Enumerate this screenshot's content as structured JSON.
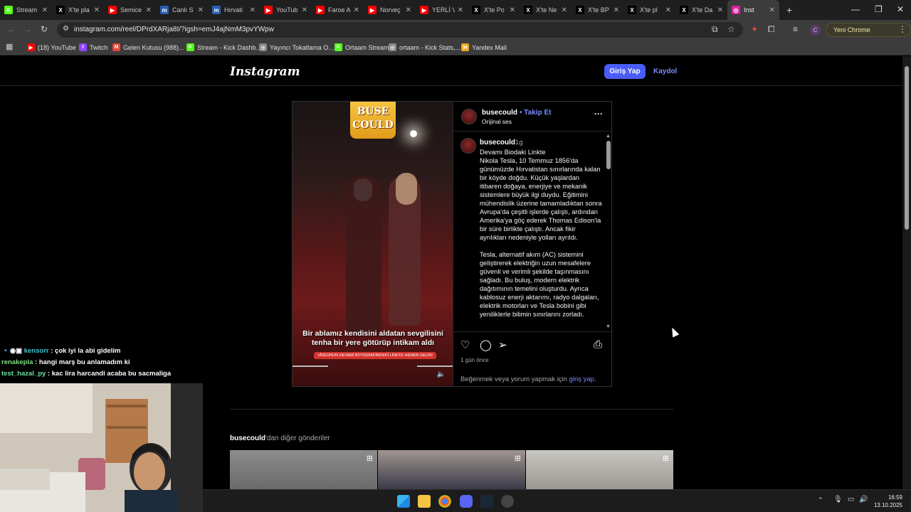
{
  "browser": {
    "tabs": [
      {
        "label": "Stream",
        "color": "#53fc18",
        "glyph": "K"
      },
      {
        "label": "X'te pla",
        "color": "#000000",
        "glyph": "X"
      },
      {
        "label": "Semice",
        "color": "#ff0000",
        "glyph": "▶"
      },
      {
        "label": "Canlı S",
        "color": "#2a5db0",
        "glyph": "m"
      },
      {
        "label": "Hırvati",
        "color": "#2a5db0",
        "glyph": "m"
      },
      {
        "label": "YouTub",
        "color": "#ff0000",
        "glyph": "▶"
      },
      {
        "label": "Faroe A",
        "color": "#ff0000",
        "glyph": "▶"
      },
      {
        "label": "Norveç",
        "color": "#ff0000",
        "glyph": "▶"
      },
      {
        "label": "YERLİ V",
        "color": "#ff0000",
        "glyph": "▶"
      },
      {
        "label": "X'te Po",
        "color": "#000000",
        "glyph": "X"
      },
      {
        "label": "X'te Ne",
        "color": "#000000",
        "glyph": "X"
      },
      {
        "label": "X'te BP",
        "color": "#000000",
        "glyph": "X"
      },
      {
        "label": "X'te pl",
        "color": "#000000",
        "glyph": "X"
      },
      {
        "label": "X'te Da",
        "color": "#000000",
        "glyph": "X"
      },
      {
        "label": "Inst",
        "color": "#d6249f",
        "glyph": "◎",
        "active": true
      }
    ],
    "new_tab": "+",
    "url": "instagram.com/reel/DPrdXARja8I/?igsh=emJ4ajNmM3pvYWpw",
    "update_button": "Yeni Chrome kullanılabilir",
    "profile_initial": "C",
    "bookmarks": [
      {
        "label": "(18) YouTube",
        "color": "#ff0000",
        "glyph": "▶"
      },
      {
        "label": "Twitch",
        "color": "#9146ff",
        "glyph": "t"
      },
      {
        "label": "Gelen Kutusu (988)...",
        "color": "#ea4335",
        "glyph": "M"
      },
      {
        "label": "Stream - Kick Dashb...",
        "color": "#53fc18",
        "glyph": "K"
      },
      {
        "label": "Yayıncı Tokatlama O...",
        "color": "#888888",
        "glyph": "◎"
      },
      {
        "label": "Ortaam Stream",
        "color": "#53fc18",
        "glyph": "K"
      },
      {
        "label": "ortaam - Kick Stats,...",
        "color": "#888888",
        "glyph": "◎"
      },
      {
        "label": "Yandex Mail",
        "color": "#f5a623",
        "glyph": "✉"
      }
    ]
  },
  "instagram": {
    "logo": "Instagram",
    "login_button": "Giriş Yap",
    "signup_link": "Kaydol",
    "post": {
      "username": "busecould",
      "separator": "•",
      "follow": "Takip Et",
      "audio": "Orijinal ses",
      "more": "···",
      "badge_line1": "BUSE",
      "badge_line2": "COULD",
      "video_caption": "Bir ablamız kendisini aldatan sevgilisini tenha bir yere götürüp intikam aldı",
      "video_pill": "VİDEONUN DEVAMI BİYOGRAFİMDEKİ LİNKTE HEMEN GELİN!",
      "comment_user": "busecould",
      "comment_time": "1g",
      "comment_text": "Devamı Biodaki Linkte\nNikola Tesla, 10 Temmuz 1856'da günümüzde Hırvatistan sınırlarında kalan bir köyde doğdu. Küçük yaşlardan itibaren doğaya, enerjiye ve mekanik sistemlere büyük ilgi duydu. Eğitimini mühendislik üzerine tamamladıktan sonra Avrupa'da çeşitli işlerde çalıştı, ardından Amerika'ya göç ederek Thomas Edison'la bir süre birlikte çalıştı. Ancak fikir ayrılıkları nedeniyle yolları ayrıldı.\n\nTesla, alternatif akım (AC) sistemini geliştirerek elektriğin uzun mesafelere güvenli ve verimli şekilde taşınmasını sağladı. Bu buluş, modern elektrik dağıtımının temelini oluşturdu. Ayrıca kablosuz enerji aktarımı, radyo dalgaları, elektrik motorları ve Tesla bobini gibi yeniliklerle bilimin sınırlarını zorladı.",
      "posted_ago": "1 gün önce",
      "login_prompt": "Beğenmek veya yorum yapmak için ",
      "login_prompt_link": "giriş yap",
      "login_prompt_end": "."
    },
    "more_posts": {
      "user": "busecould",
      "suffix": "'dan diğer gönderiler"
    }
  },
  "chat": [
    {
      "nick": "kensorr",
      "msg": " : çok iyi la abi gidelim",
      "badges": "🔹◉▣ "
    },
    {
      "nick": "renakepla",
      "msg": " : hangi marş bu anlamadım ki",
      "badges": ""
    },
    {
      "nick": "test_hazal_py",
      "msg": " : kac lira harcandi acaba bu sacmaliga",
      "badges": ""
    }
  ],
  "taskbar": {
    "time": "16:59",
    "date": "13.10.2025"
  }
}
